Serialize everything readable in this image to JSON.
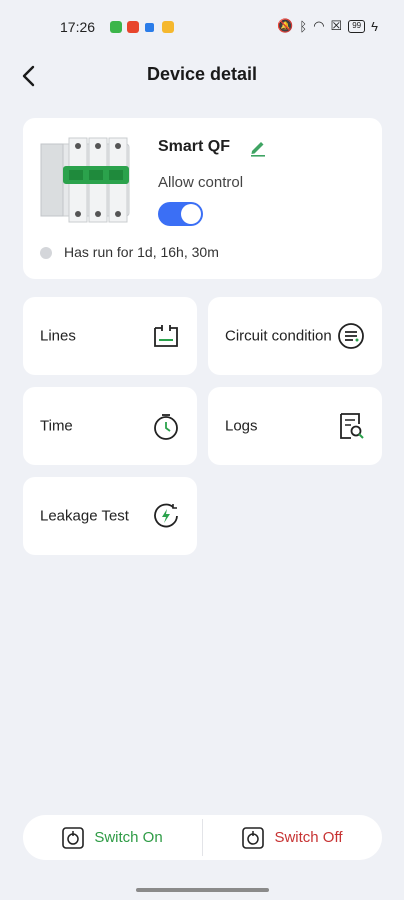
{
  "status_bar": {
    "time": "17:26",
    "battery": "99"
  },
  "header": {
    "title": "Device detail"
  },
  "device": {
    "name": "Smart QF",
    "allow_control_label": "Allow control",
    "allow_control_on": true,
    "run_status": "Has run for 1d, 16h, 30m"
  },
  "tiles": [
    {
      "label": "Lines",
      "icon": "lines-icon"
    },
    {
      "label": "Circuit condition",
      "icon": "circuit-condition-icon"
    },
    {
      "label": "Time",
      "icon": "timer-icon"
    },
    {
      "label": "Logs",
      "icon": "logs-search-icon"
    },
    {
      "label": "Leakage Test",
      "icon": "leakage-test-icon"
    }
  ],
  "actions": {
    "switch_on": "Switch On",
    "switch_off": "Switch Off"
  },
  "colors": {
    "accent": "#3b6ff5",
    "on": "#2e9b45",
    "off": "#c73333",
    "edit": "#3fa463"
  }
}
